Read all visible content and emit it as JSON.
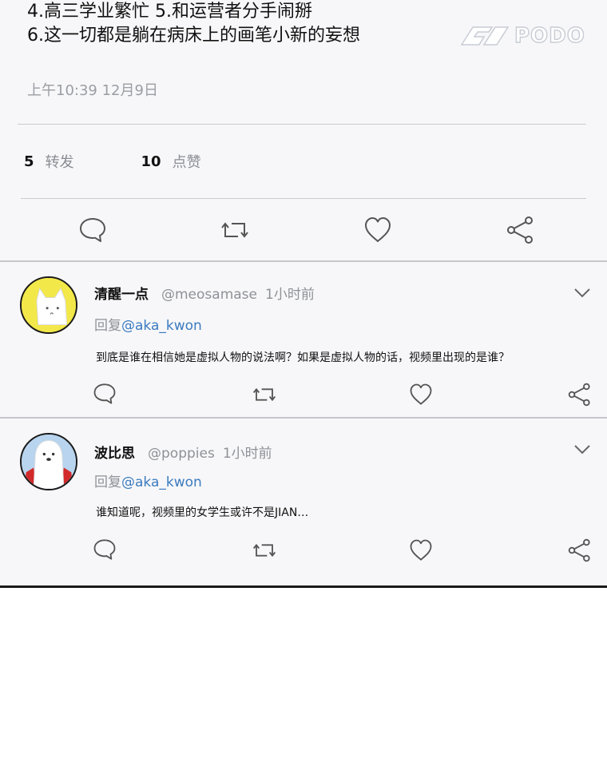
{
  "tweet": {
    "text_lines": [
      "4.高三学业繁忙 5.和运营者分手闹掰",
      "6.这一切都是躺在病床上的画笔小新的妄想"
    ],
    "timestamp": "上午10:39 12月9日",
    "retweet_count": "5",
    "retweet_label": "转发",
    "like_count": "10",
    "like_label": "点赞"
  },
  "watermark": {
    "text": "PODO"
  },
  "icons": {
    "reply": "comment-bubble-icon",
    "retweet": "retweet-arrows-icon",
    "like": "heart-icon",
    "share": "share-nodes-icon",
    "menu": "chevron-down-icon"
  },
  "replies": [
    {
      "name": "清醒一点",
      "handle": "@meosamase",
      "time": "1小时前",
      "reply_prefix": "回复",
      "reply_to": "@aka_kwon",
      "text": "到底是谁在相信她是虚拟人物的说法啊？如果是虚拟人物的话，视频里出现的是谁？"
    },
    {
      "name": "波比思",
      "handle": "@poppies",
      "time": "1小时前",
      "reply_prefix": "回复",
      "reply_to": "@aka_kwon",
      "text": "谁知道呢，视频里的女学生或许不是JIAN…"
    }
  ],
  "colors": {
    "mention": "#3b7bbf",
    "muted": "#8e9197",
    "avatar1_bg": "#f3e84a",
    "avatar2_bg": "#b8d4ee"
  }
}
